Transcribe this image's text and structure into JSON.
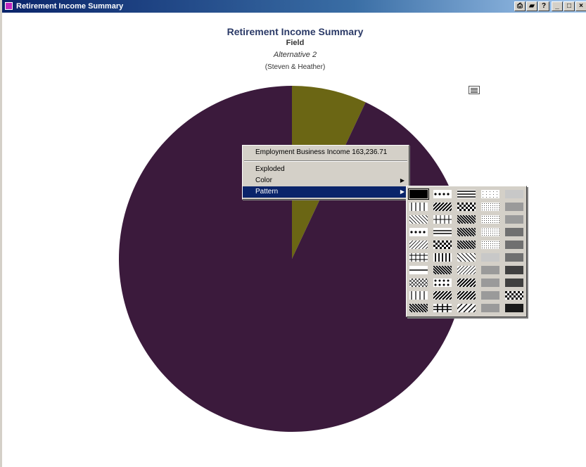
{
  "window": {
    "title": "Retirement Income Summary",
    "buttons": [
      {
        "name": "print-icon",
        "glyph": "⎙"
      },
      {
        "name": "folder-icon",
        "glyph": "▰"
      },
      {
        "name": "help-icon",
        "glyph": "?"
      },
      {
        "name": "minimize-icon",
        "glyph": "_"
      },
      {
        "name": "maximize-icon",
        "glyph": "□"
      },
      {
        "name": "close-icon",
        "glyph": "×"
      }
    ]
  },
  "report": {
    "title": "Retirement Income Summary",
    "field": "Field",
    "alternative": "Alternative 2",
    "names": "(Steven & Heather)"
  },
  "chart_data": {
    "type": "pie",
    "slices": [
      {
        "fraction": 0.07,
        "color": "#6b6614"
      },
      {
        "fraction": 0.93,
        "color": "#3b1a3c"
      }
    ]
  },
  "context_menu": {
    "header": "Employment  Business Income  163,236.71",
    "items": [
      {
        "label": "Exploded",
        "submenu": false,
        "highlighted": false
      },
      {
        "label": "Color",
        "submenu": true,
        "highlighted": false
      },
      {
        "label": "Pattern",
        "submenu": true,
        "highlighted": true
      }
    ],
    "submenu_arrow": "▶"
  },
  "pattern_palette": {
    "rows": 10,
    "cols": 5,
    "selected_index": 0,
    "patterns": [
      "solid",
      "dots",
      "hbars",
      "sparse-dots",
      "gray-light",
      "vlines",
      "diag-thick",
      "checker-bold",
      "fine-dots",
      "gray-mid",
      "diag-thin-back",
      "cross",
      "diag-back",
      "fine-dots",
      "gray-mid",
      "dots",
      "hbars-double",
      "diag-back-bold",
      "fine-dots",
      "gray-dark",
      "diag-thin",
      "checker-bold",
      "diag-back-bold",
      "fine-dots",
      "gray-dark",
      "grid",
      "vlines-thick",
      "diag-back-sparse",
      "gray-light",
      "gray-dark",
      "hline",
      "diag-back-bold",
      "diag-thin",
      "gray-mid",
      "gray-darker",
      "diamond",
      "dots-bold",
      "diag-bold",
      "gray-mid",
      "gray-darker",
      "vlines",
      "diag-bold",
      "diag-bold",
      "gray-mid",
      "checker-bold",
      "diag-back-bold",
      "cross-bold",
      "diag-sparse",
      "gray-mid",
      "gray-darkest"
    ]
  }
}
